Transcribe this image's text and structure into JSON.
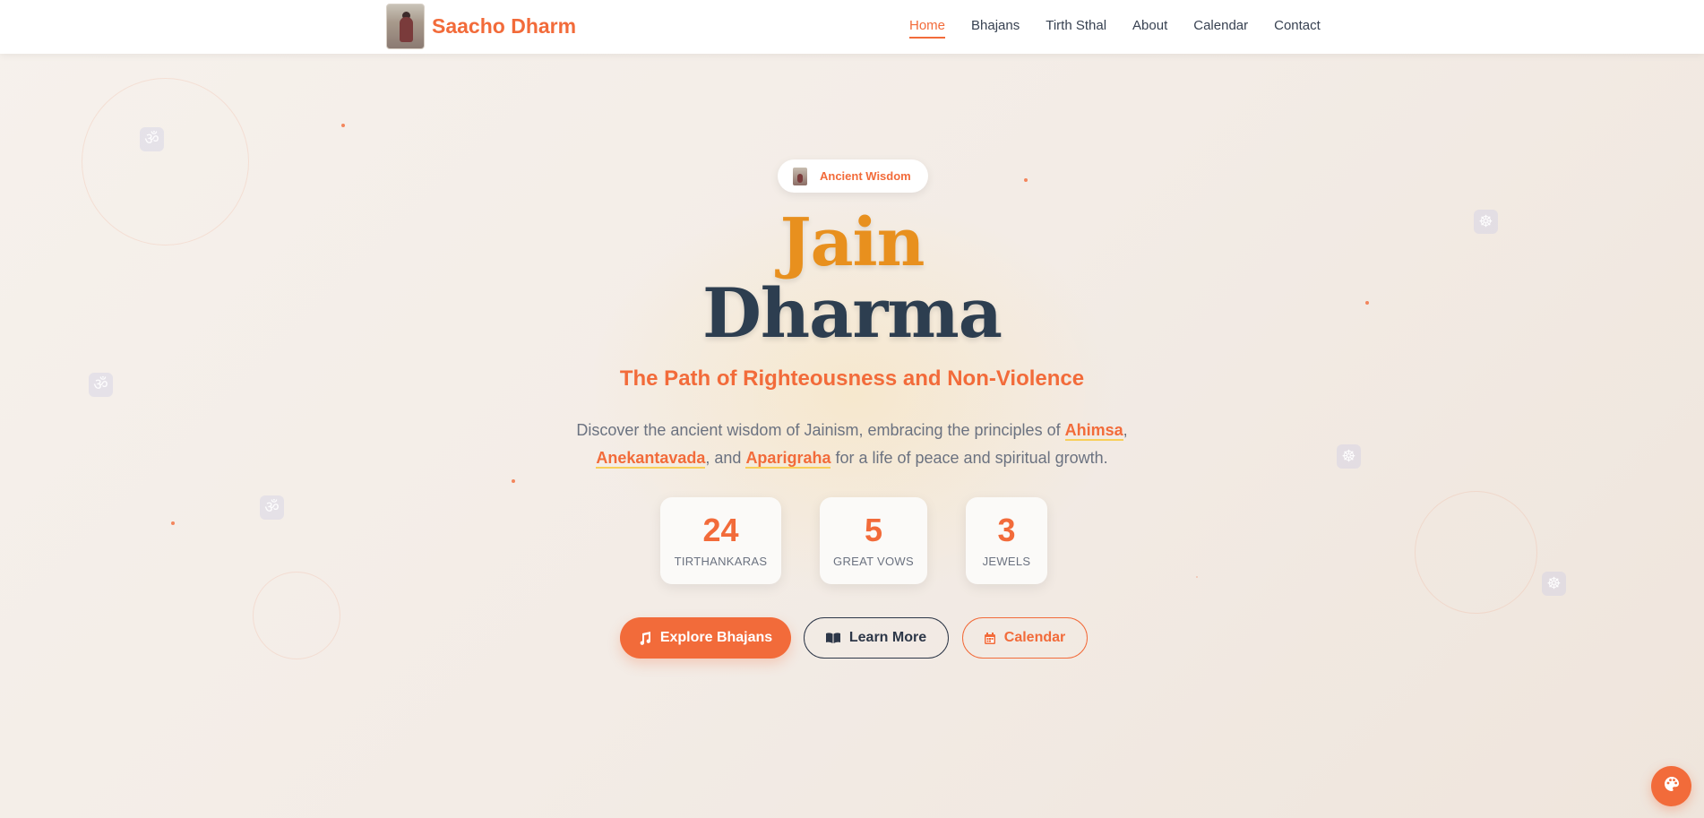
{
  "header": {
    "brand_name": "Saacho Dharm",
    "nav": [
      {
        "label": "Home",
        "active": true
      },
      {
        "label": "Bhajans",
        "active": false
      },
      {
        "label": "Tirth Sthal",
        "active": false
      },
      {
        "label": "About",
        "active": false
      },
      {
        "label": "Calendar",
        "active": false
      },
      {
        "label": "Contact",
        "active": false
      }
    ]
  },
  "hero": {
    "badge": "Ancient Wisdom",
    "title_line1": "Jain",
    "title_line2": "Dharma",
    "subtitle": "The Path of Righteousness and Non-Violence",
    "description": {
      "part1": "Discover the ancient wisdom of Jainism, embracing the principles of ",
      "term1": "Ahimsa",
      "part2": ",",
      "term2": "Anekantavada",
      "part3": ", and ",
      "term3": "Aparigraha",
      "part4": " for a life of peace and spiritual growth."
    },
    "stats": [
      {
        "number": "24",
        "label": "TIRTHANKARAS"
      },
      {
        "number": "5",
        "label": "GREAT VOWS"
      },
      {
        "number": "3",
        "label": "JEWELS"
      }
    ],
    "buttons": {
      "primary": "Explore Bhajans",
      "secondary": "Learn More",
      "tertiary": "Calendar"
    }
  },
  "decor": {
    "om_symbol": "ॐ",
    "dharma_wheel_symbol": "☸"
  },
  "icons": {
    "primary_button_icon": "music-note-icon",
    "secondary_button_icon": "book-icon",
    "tertiary_button_icon": "calendar-icon",
    "floating_button_icon": "palette-icon"
  },
  "colors": {
    "accent": "#f26b3a",
    "title_gold": "#e8901e",
    "title_dark": "#2d3e50",
    "highlight_underline": "#f8cf5a"
  }
}
